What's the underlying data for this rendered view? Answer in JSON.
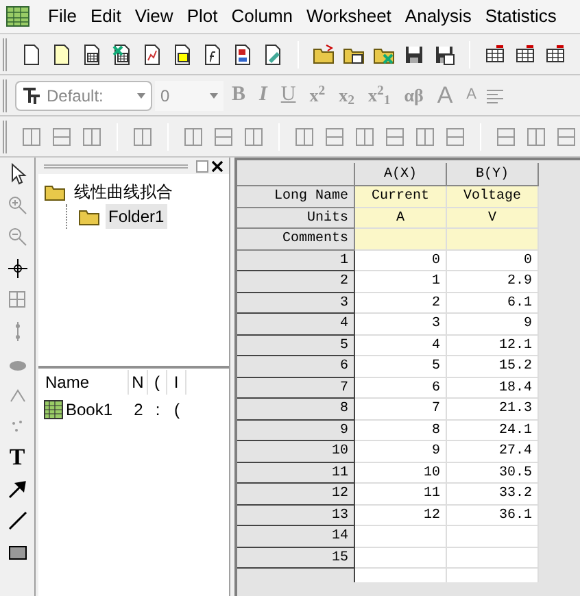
{
  "menu": [
    "File",
    "Edit",
    "View",
    "Plot",
    "Column",
    "Worksheet",
    "Analysis",
    "Statistics"
  ],
  "format_toolbar": {
    "font": "Default:",
    "size": "0",
    "glyphs": [
      {
        "text": "B",
        "kind": "bold"
      },
      {
        "text": "I",
        "kind": "italic"
      },
      {
        "text": "U",
        "kind": "underline"
      },
      {
        "text": "x$^{2}$",
        "kind": "plain"
      },
      {
        "text": "x$_{2}$",
        "kind": "plain"
      },
      {
        "text": "x$^{2}$$_{1}$",
        "kind": "plain"
      },
      {
        "text": "αβ",
        "kind": "plain"
      },
      {
        "text": "A",
        "kind": "large"
      },
      {
        "text": "A",
        "kind": "small"
      }
    ]
  },
  "tools": {
    "text_tool": "T"
  },
  "project_explorer": {
    "tree": [
      {
        "label": "线性曲线拟合",
        "selected": false,
        "children": [
          {
            "label": "Folder1",
            "selected": true
          }
        ]
      }
    ],
    "list_columns": [
      "Name",
      "N",
      "(",
      "I"
    ],
    "list_rows": [
      {
        "cells": [
          "Book1",
          "2",
          ":",
          "("
        ]
      }
    ]
  },
  "worksheet": {
    "columns": [
      "A(X)",
      "B(Y)"
    ],
    "meta_rows": [
      {
        "label": "Long Name",
        "values": [
          "Current",
          "Voltage"
        ]
      },
      {
        "label": "Units",
        "values": [
          "A",
          "V"
        ]
      },
      {
        "label": "Comments"
      }
    ],
    "rows": [
      {
        "n": "1",
        "values": [
          "0",
          "0"
        ]
      },
      {
        "n": "2",
        "values": [
          "1",
          "2.9"
        ]
      },
      {
        "n": "3",
        "values": [
          "2",
          "6.1"
        ]
      },
      {
        "n": "4",
        "values": [
          "3",
          "9"
        ]
      },
      {
        "n": "5",
        "values": [
          "4",
          "12.1"
        ]
      },
      {
        "n": "6",
        "values": [
          "5",
          "15.2"
        ]
      },
      {
        "n": "7",
        "values": [
          "6",
          "18.4"
        ]
      },
      {
        "n": "8",
        "values": [
          "7",
          "21.3"
        ]
      },
      {
        "n": "9",
        "values": [
          "8",
          "24.1"
        ]
      },
      {
        "n": "10",
        "values": [
          "9",
          "27.4"
        ]
      },
      {
        "n": "11",
        "values": [
          "10",
          "30.5"
        ]
      },
      {
        "n": "12",
        "values": [
          "11",
          "33.2"
        ]
      },
      {
        "n": "13",
        "values": [
          "12",
          "36.1"
        ]
      },
      {
        "n": "14"
      },
      {
        "n": "15"
      }
    ]
  }
}
